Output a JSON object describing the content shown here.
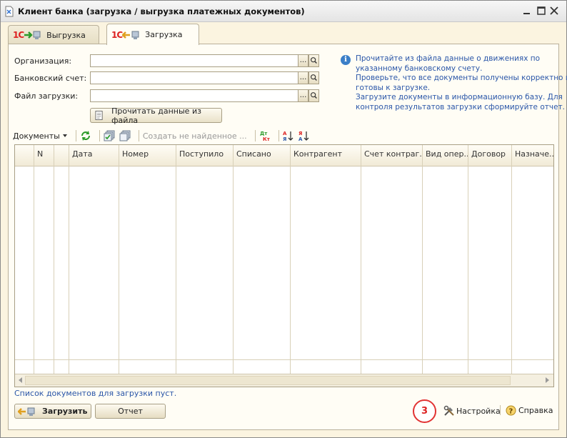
{
  "window": {
    "title": "Клиент банка (загрузка / выгрузка платежных документов)"
  },
  "tabs": [
    {
      "logo": "1С",
      "label": "Выгрузка",
      "active": false
    },
    {
      "logo": "1С",
      "label": "Загрузка",
      "active": true
    }
  ],
  "form": {
    "organization_label": "Организация:",
    "organization_value": "",
    "bank_account_label": "Банковский счет:",
    "bank_account_value": "",
    "file_label": "Файл загрузки:",
    "file_value": "",
    "dots_label": "...",
    "read_button_label": "Прочитать данные из файла"
  },
  "info": {
    "lines": [
      "Прочитайте из файла данные о движениях по",
      "указанному банковскому счету.",
      "Проверьте, что все  документы получены корректно и",
      "готовы к загрузке.",
      "Загрузите документы в информационную базу. Для",
      "контроля результатов загрузки сформируйте отчет."
    ]
  },
  "toolbar": {
    "documents_label": "Документы",
    "create_missing_label": "Создать не найденное ..."
  },
  "grid": {
    "columns": [
      "",
      "N",
      "",
      "Дата",
      "Номер",
      "Поступило",
      "Списано",
      "Контрагент",
      "Счет контраг...",
      "Вид опер...",
      "Договор",
      "Назначе..."
    ]
  },
  "status": {
    "text": "Список документов для загрузки пуст."
  },
  "buttons": {
    "load_label": "Загрузить",
    "report_label": "Отчет"
  },
  "badge": {
    "number": "3"
  },
  "links": {
    "settings_label": "Настройка",
    "help_label": "Справка"
  },
  "colors": {
    "background": "#fbf4e0",
    "info_text": "#2a56a8",
    "badge_ring": "#e23333"
  }
}
